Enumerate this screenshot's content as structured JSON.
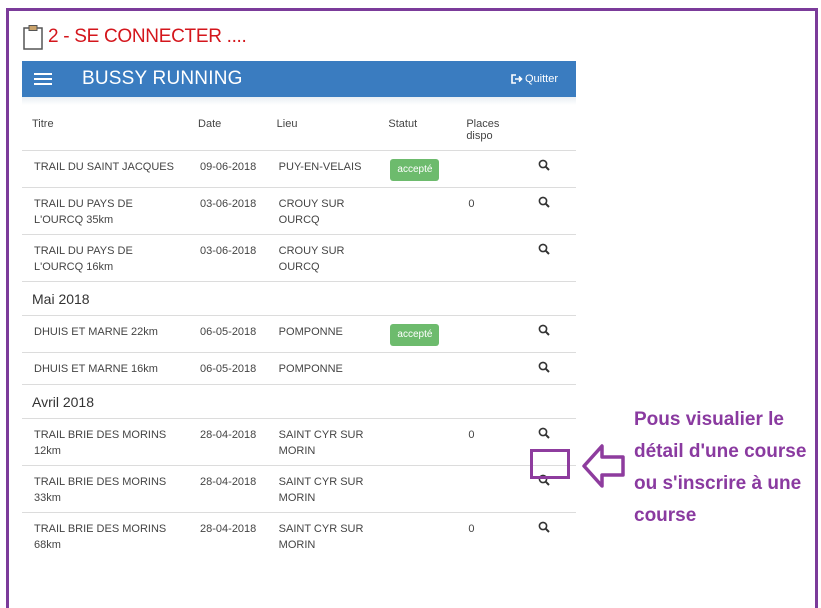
{
  "step_title": "2 - SE CONNECTER ....",
  "app": {
    "brand": "BUSSY RUNNING",
    "quit_label": "Quitter"
  },
  "table": {
    "headers": {
      "titre": "Titre",
      "date": "Date",
      "lieu": "Lieu",
      "statut": "Statut",
      "places": "Places dispo"
    },
    "rows": [
      {
        "type": "race",
        "titre": "TRAIL DU SAINT JACQUES",
        "date": "09-06-2018",
        "lieu": "PUY-EN-VELAIS",
        "statut": "accepté",
        "places": ""
      },
      {
        "type": "race",
        "titre": "TRAIL DU PAYS DE L'OURCQ 35km",
        "date": "03-06-2018",
        "lieu": "CROUY SUR OURCQ",
        "statut": "",
        "places": "0"
      },
      {
        "type": "race",
        "titre": "TRAIL DU PAYS DE L'OURCQ 16km",
        "date": "03-06-2018",
        "lieu": "CROUY SUR OURCQ",
        "statut": "",
        "places": ""
      },
      {
        "type": "month",
        "label": "Mai 2018"
      },
      {
        "type": "race",
        "titre": "DHUIS ET MARNE 22km",
        "date": "06-05-2018",
        "lieu": "POMPONNE",
        "statut": "accepté",
        "places": ""
      },
      {
        "type": "race",
        "titre": "DHUIS ET MARNE 16km",
        "date": "06-05-2018",
        "lieu": "POMPONNE",
        "statut": "",
        "places": ""
      },
      {
        "type": "month",
        "label": "Avril 2018"
      },
      {
        "type": "race",
        "titre": "TRAIL BRIE DES MORINS 12km",
        "date": "28-04-2018",
        "lieu": "SAINT CYR SUR MORIN",
        "statut": "",
        "places": "0"
      },
      {
        "type": "race",
        "titre": "TRAIL BRIE DES MORINS 33km",
        "date": "28-04-2018",
        "lieu": "SAINT CYR SUR MORIN",
        "statut": "",
        "places": ""
      },
      {
        "type": "race",
        "titre": "TRAIL BRIE DES MORINS 68km",
        "date": "28-04-2018",
        "lieu": "SAINT CYR SUR MORIN",
        "statut": "",
        "places": "0"
      }
    ]
  },
  "annotation": {
    "text": "Pous visualier le détail d'une course ou s'inscrire à une course",
    "color": "#8a3aa0"
  },
  "colors": {
    "navbar": "#3a7cc0",
    "badge": "#6dbb6d",
    "step_title": "#d4161c",
    "frame": "#7b3b9a"
  },
  "icons": {
    "step": "clipboard-icon",
    "menu": "hamburger-icon",
    "quit": "sign-out-icon",
    "row_action": "magnifier-icon",
    "pointer": "arrow-left-icon"
  }
}
